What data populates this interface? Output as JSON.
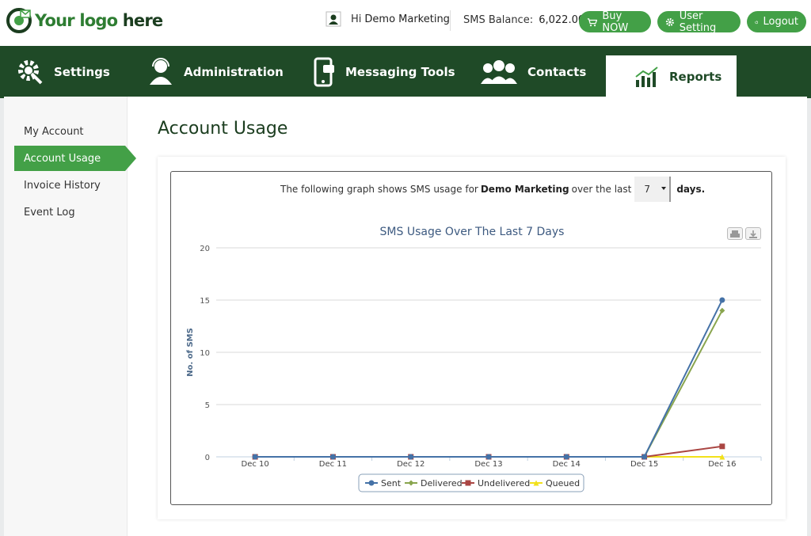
{
  "header": {
    "logo_text_1": "Your logo",
    "logo_text_2": "here",
    "greeting": "Hi",
    "user_name": "Demo Marketing",
    "balance_label": "SMS Balance:",
    "balance_value": "6,022.00",
    "buy_label": "Buy NOW",
    "user_setting_label": "User Setting",
    "logout_label": "Logout"
  },
  "nav": {
    "settings": "Settings",
    "administration": "Administration",
    "messaging": "Messaging Tools",
    "contacts": "Contacts",
    "reports": "Reports"
  },
  "sidebar": {
    "items": [
      {
        "label": "My Account"
      },
      {
        "label": "Account Usage"
      },
      {
        "label": "Invoice History"
      },
      {
        "label": "Event Log"
      }
    ]
  },
  "page": {
    "title": "Account Usage",
    "desc_prefix": "The following graph shows SMS usage for",
    "desc_user": "Demo Marketing",
    "desc_mid": "over the last",
    "days_value": "7",
    "desc_suffix": "days."
  },
  "colors": {
    "brand_green": "#43a047",
    "nav_dark": "#1f4a27",
    "sent": "#4572a7",
    "delivered": "#89a54e",
    "undelivered": "#aa4643",
    "queued": "#f2e11a"
  },
  "chart_data": {
    "type": "line",
    "title": "SMS Usage Over The Last 7 Days",
    "ylabel": "No. of SMS",
    "xlabel": "",
    "categories": [
      "Dec 10",
      "Dec 11",
      "Dec 12",
      "Dec 13",
      "Dec 14",
      "Dec 15",
      "Dec 16"
    ],
    "ylim": [
      0,
      20
    ],
    "yticks": [
      0,
      5,
      10,
      15,
      20
    ],
    "grid": true,
    "legend": "bottom",
    "series": [
      {
        "name": "Sent",
        "values": [
          0,
          0,
          0,
          0,
          0,
          0,
          15
        ]
      },
      {
        "name": "Delivered",
        "values": [
          0,
          0,
          0,
          0,
          0,
          0,
          14
        ]
      },
      {
        "name": "Undelivered",
        "values": [
          0,
          0,
          0,
          0,
          0,
          0,
          1
        ]
      },
      {
        "name": "Queued",
        "values": [
          0,
          0,
          0,
          0,
          0,
          0,
          0
        ]
      }
    ]
  }
}
